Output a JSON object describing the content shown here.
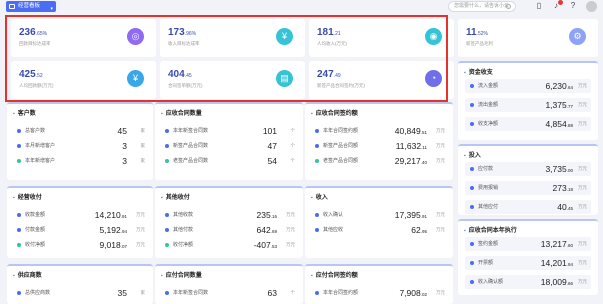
{
  "topbar": {
    "dashboard_label": "经营看板",
    "search_placeholder": "您需要什么，请告诉小云"
  },
  "kpis": [
    {
      "value": "236",
      "decimals": ".65%",
      "label": "回款目标达成率",
      "color": "#8e6bf0",
      "icon": "target-icon",
      "glyph": "◎"
    },
    {
      "value": "173",
      "decimals": ".96%",
      "label": "收入目标达成率",
      "color": "#36c3d6",
      "icon": "revenue-icon",
      "glyph": "¥"
    },
    {
      "value": "181",
      "decimals": ".21",
      "label": "人均收入(万元)",
      "color": "#36c3d6",
      "icon": "person-income-icon",
      "glyph": "◉"
    },
    {
      "value": "11",
      "decimals": ".52%",
      "label": "新签产品毛利",
      "color": "#8ea3f5",
      "icon": "margin-icon",
      "glyph": "⚙"
    },
    {
      "value": "425",
      "decimals": ".52",
      "label": "人均回款额(万元)",
      "color": "#3aa7e6",
      "icon": "payment-icon",
      "glyph": "¥"
    },
    {
      "value": "404",
      "decimals": ".45",
      "label": "合同签单额(万元)",
      "color": "#36c3d6",
      "icon": "contract-icon",
      "glyph": "▤"
    },
    {
      "value": "247",
      "decimals": ".49",
      "label": "新签产品合同签约(万元)",
      "color": "#6f6fe8",
      "icon": "user-icon",
      "glyph": "◔"
    }
  ],
  "panels": [
    {
      "title": "客户数",
      "rows": [
        {
          "label": "总客户数",
          "value": "45",
          "dec": "",
          "unit": "家",
          "color": "#4a6cf7"
        },
        {
          "label": "本月新增客户",
          "value": "3",
          "dec": "",
          "unit": "家",
          "color": "#4a6cf7"
        },
        {
          "label": "本年新增客户",
          "value": "3",
          "dec": "",
          "unit": "家",
          "color": "#36c3a0"
        }
      ]
    },
    {
      "title": "应收合同数量",
      "rows": [
        {
          "label": "本年新签合同数",
          "value": "101",
          "dec": "",
          "unit": "个",
          "color": "#4a6cf7"
        },
        {
          "label": "新签产品合同数",
          "value": "47",
          "dec": "",
          "unit": "个",
          "color": "#4a6cf7"
        },
        {
          "label": "老签产品合同数",
          "value": "54",
          "dec": "",
          "unit": "个",
          "color": "#36c3a0"
        }
      ]
    },
    {
      "title": "应收合同签约额",
      "rows": [
        {
          "label": "本年合同签约额",
          "value": "40,849",
          "dec": ".51",
          "unit": "万元",
          "color": "#4a6cf7"
        },
        {
          "label": "新签产品合同额",
          "value": "11,632",
          "dec": ".11",
          "unit": "万元",
          "color": "#4a6cf7"
        },
        {
          "label": "老签产品合同额",
          "value": "29,217",
          "dec": ".40",
          "unit": "万元",
          "color": "#36c3a0"
        }
      ]
    },
    {
      "title": "经营收付",
      "rows": [
        {
          "label": "收款金额",
          "value": "14,210",
          "dec": ".91",
          "unit": "万元",
          "color": "#4a6cf7"
        },
        {
          "label": "付款金额",
          "value": "5,192",
          "dec": ".94",
          "unit": "万元",
          "color": "#4a6cf7"
        },
        {
          "label": "收付净额",
          "value": "9,018",
          "dec": ".07",
          "unit": "万元",
          "color": "#36c3a0"
        }
      ]
    },
    {
      "title": "其他收付",
      "rows": [
        {
          "label": "其他收款",
          "value": "235",
          "dec": ".16",
          "unit": "万元",
          "color": "#4a6cf7"
        },
        {
          "label": "其他付款",
          "value": "642",
          "dec": ".69",
          "unit": "万元",
          "color": "#4a6cf7"
        },
        {
          "label": "收付净额",
          "value": "-407",
          "dec": ".53",
          "unit": "万元",
          "color": "#36c3a0"
        }
      ]
    },
    {
      "title": "收入",
      "rows": [
        {
          "label": "收入确认",
          "value": "17,395",
          "dec": ".91",
          "unit": "万元",
          "color": "#4a6cf7"
        },
        {
          "label": "其他应收",
          "value": "62",
          "dec": ".95",
          "unit": "万元",
          "color": "#4a6cf7"
        }
      ]
    },
    {
      "title": "供应商数",
      "rows": [
        {
          "label": "总供应商数",
          "value": "35",
          "dec": "",
          "unit": "家",
          "color": "#4a6cf7"
        }
      ]
    },
    {
      "title": "应付合同数量",
      "rows": [
        {
          "label": "本年新签合同数",
          "value": "63",
          "dec": "",
          "unit": "个",
          "color": "#4a6cf7"
        }
      ]
    },
    {
      "title": "应付合同签约额",
      "rows": [
        {
          "label": "本年合同签约额",
          "value": "7,908",
          "dec": ".02",
          "unit": "万元",
          "color": "#4a6cf7"
        }
      ]
    }
  ],
  "right_panels": [
    {
      "title": "资金收支",
      "rows": [
        {
          "label": "流入金额",
          "value": "6,230",
          "dec": ".64",
          "unit": "万元"
        },
        {
          "label": "流出金额",
          "value": "1,375",
          "dec": ".77",
          "unit": "万元"
        },
        {
          "label": "收支净额",
          "value": "4,854",
          "dec": ".88",
          "unit": "万元"
        }
      ]
    },
    {
      "title": "投入",
      "rows": [
        {
          "label": "应付款",
          "value": "3,735",
          "dec": ".00",
          "unit": "万元"
        },
        {
          "label": "费用报销",
          "value": "273",
          "dec": ".18",
          "unit": "万元"
        },
        {
          "label": "其他应付",
          "value": "40",
          "dec": ".45",
          "unit": "万元"
        }
      ]
    },
    {
      "title": "应收合同本年执行",
      "rows": [
        {
          "label": "签约金额",
          "value": "13,217",
          "dec": ".60",
          "unit": "万元"
        },
        {
          "label": "开票额",
          "value": "14,201",
          "dec": ".94",
          "unit": "万元"
        },
        {
          "label": "收入确认额",
          "value": "18,009",
          "dec": ".66",
          "unit": "万元"
        }
      ]
    }
  ]
}
